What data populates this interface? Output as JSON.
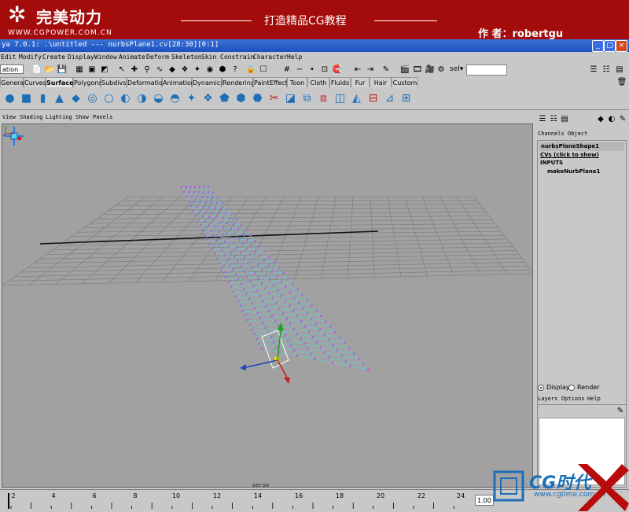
{
  "banner": {
    "logo_text": "完美动力",
    "site_url": "WWW.CGPOWER.COM.CN",
    "center_title": "打造精品CG教程",
    "author": "作 者：robertgu"
  },
  "window": {
    "title": "ya 7.0.1: .\\untitled    ---    nurbsPlane1.cv[28:30][0:1]",
    "buttons": {
      "minimize": "_",
      "maximize": "□",
      "close": "×"
    }
  },
  "menubar": {
    "items": [
      "Edit",
      "Modify",
      "Create",
      "Display",
      "Window",
      "Animate",
      "Deform",
      "Skeleton",
      "Skin",
      "Constrain",
      "Character",
      "Help"
    ]
  },
  "statusline": {
    "mode_value": "ation",
    "sel_label": "sel▾",
    "sel_value": ""
  },
  "shelf": {
    "tabs": [
      "General",
      "Curves",
      "Surfaces",
      "Polygons",
      "Subdivs",
      "Deformation",
      "Animation",
      "Dynamics",
      "Rendering",
      "PaintEffects",
      "Toon",
      "Cloth",
      "Fluids",
      "Fur",
      "Hair",
      "Custom"
    ],
    "active_tab": "Surfaces"
  },
  "panel": {
    "menu": [
      "View",
      "Shading",
      "Lighting",
      "Show",
      "Panels"
    ],
    "camera_label": "persp"
  },
  "channel_box": {
    "tabs": [
      "Channels",
      "Object"
    ],
    "shape_name": "nurbsPlaneShape1",
    "cvs_label": "CVs (click to show)",
    "inputs_label": "INPUTS",
    "input_node": "makeNurbPlane1"
  },
  "layers": {
    "display_option": "Display",
    "render_option": "Render",
    "display_selected": true,
    "menu": [
      "Layers",
      "Options",
      "Help"
    ]
  },
  "timeslider": {
    "ticks": [
      "2",
      "4",
      "6",
      "8",
      "10",
      "12",
      "14",
      "16",
      "18",
      "20",
      "22",
      "24"
    ],
    "current_frame": "1.00"
  },
  "watermark": {
    "text": "CG时代",
    "url": "www.cgtime.com.cn"
  },
  "colors": {
    "banner_red": "#a40c0c",
    "titlebar_blue": "#1d50c0",
    "viewport_bg": "#a1a1a1",
    "cv_magenta": "#d03ad0",
    "hull_cyan": "#5ad2e0"
  }
}
